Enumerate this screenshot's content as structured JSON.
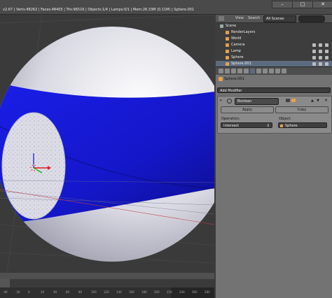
{
  "info_bar": {
    "text": "v2.67 | Verts:48262 | Faces:48405 | Tris:96516 | Objects:1/4 | Lamps:0/1 | Mem:26.33M (0.11M) | Sphere.001"
  },
  "outliner": {
    "view_label": "View",
    "search_label": "Search",
    "scope_value": "All Scenes",
    "items": [
      {
        "label": "Scene",
        "icon": "scene-icon"
      },
      {
        "label": "RenderLayers",
        "icon": "renderlayers-icon"
      },
      {
        "label": "World",
        "icon": "world-icon"
      },
      {
        "label": "Camera",
        "icon": "camera-icon"
      },
      {
        "label": "Lamp",
        "icon": "lamp-icon"
      },
      {
        "label": "Sphere",
        "icon": "mesh-icon"
      },
      {
        "label": "Sphere.001",
        "icon": "mesh-icon"
      }
    ]
  },
  "properties": {
    "object_name": "Sphere.001",
    "add_modifier_label": "Add Modifier",
    "modifier": {
      "name": "Boolean",
      "apply_label": "Apply",
      "copy_label": "Copy",
      "operation_label": "Operation:",
      "operation_value": "Intersect",
      "object_label": "Object:",
      "object_value": "Sphere"
    }
  },
  "timeline": {
    "ticks": [
      "-40",
      "-20",
      "0",
      "20",
      "40",
      "60",
      "80",
      "100",
      "120",
      "140",
      "160",
      "180",
      "200",
      "220",
      "240",
      "260",
      "280"
    ]
  },
  "colors": {
    "accent_band": "#1518d6",
    "selection": "#e8a04c",
    "panel_bg": "#737373",
    "viewport_bg": "#3a3a3a"
  }
}
